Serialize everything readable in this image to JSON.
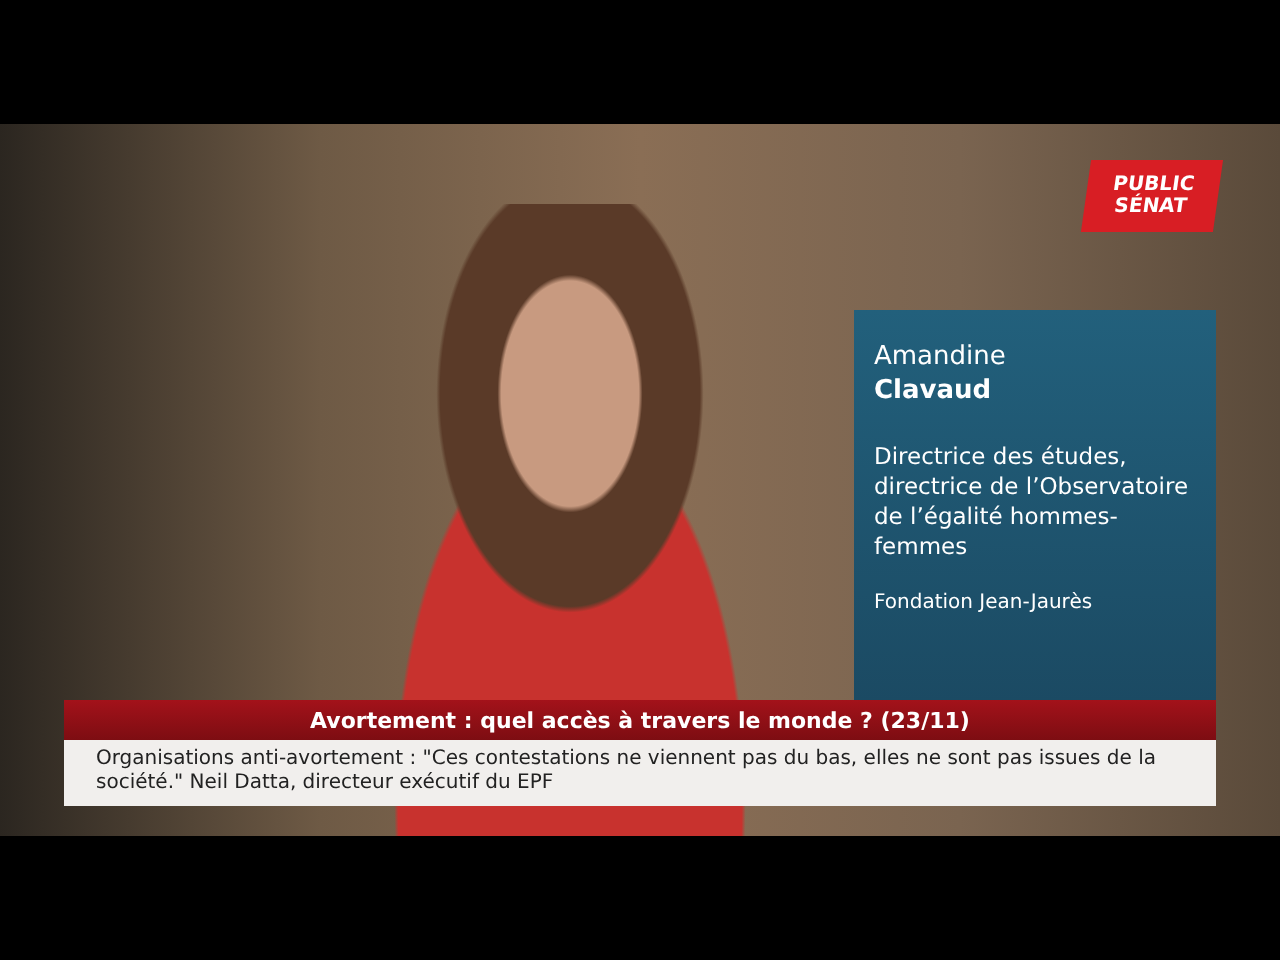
{
  "logo": {
    "line1": "PUBLIC",
    "line2": "SÉNAT"
  },
  "name_card": {
    "first_name": "Amandine",
    "last_name": "Clavaud",
    "role": "Directrice des études, directrice de l’Observatoire de l’égalité hommes-femmes",
    "organization": "Fondation Jean-Jaurès"
  },
  "headline": "Avortement : quel accès à travers le monde ? (23/11)",
  "ticker": "Organisations anti-avortement : \"Ces contestations ne viennent pas du bas, elles ne sont pas issues de la société.\" Neil Datta, directeur exécutif du EPF"
}
